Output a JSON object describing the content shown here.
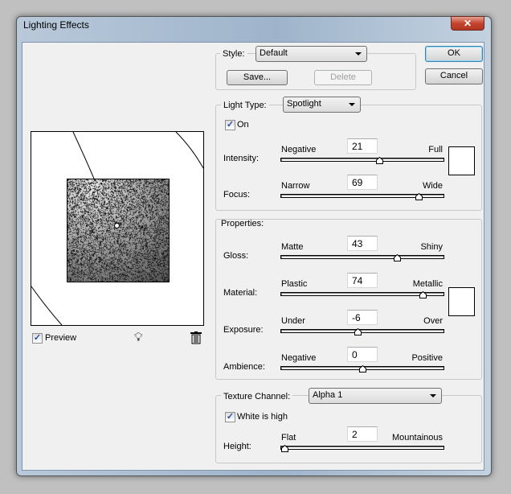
{
  "window": {
    "title": "Lighting Effects",
    "close_glyph": "✕"
  },
  "style": {
    "label": "Style:",
    "value": "Default",
    "save": "Save...",
    "delete": "Delete"
  },
  "buttons": {
    "ok": "OK",
    "cancel": "Cancel"
  },
  "light_type": {
    "label": "Light Type:",
    "value": "Spotlight",
    "on_label": "On",
    "on_checked": true,
    "intensity": {
      "label": "Intensity:",
      "left": "Negative",
      "right": "Full",
      "value": "21",
      "min": -100,
      "max": 100,
      "color": "#ffffff"
    },
    "focus": {
      "label": "Focus:",
      "left": "Narrow",
      "right": "Wide",
      "value": "69",
      "min": -100,
      "max": 100
    }
  },
  "properties": {
    "label": "Properties:",
    "gloss": {
      "label": "Gloss:",
      "left": "Matte",
      "right": "Shiny",
      "value": "43",
      "min": -100,
      "max": 100
    },
    "material": {
      "label": "Material:",
      "left": "Plastic",
      "right": "Metallic",
      "value": "74",
      "min": -100,
      "max": 100,
      "color": "#ffffff"
    },
    "exposure": {
      "label": "Exposure:",
      "left": "Under",
      "right": "Over",
      "value": "-6",
      "min": -100,
      "max": 100
    },
    "ambience": {
      "label": "Ambience:",
      "left": "Negative",
      "right": "Positive",
      "value": "0",
      "min": -100,
      "max": 100
    }
  },
  "texture": {
    "label": "Texture Channel:",
    "value": "Alpha 1",
    "white_high_label": "White is high",
    "white_high_checked": true,
    "height": {
      "label": "Height:",
      "left": "Flat",
      "right": "Mountainous",
      "value": "2",
      "min": 0,
      "max": 100
    }
  },
  "preview": {
    "label": "Preview",
    "checked": true,
    "light_icon": "lightbulb-icon",
    "trash_icon": "trash-icon"
  }
}
